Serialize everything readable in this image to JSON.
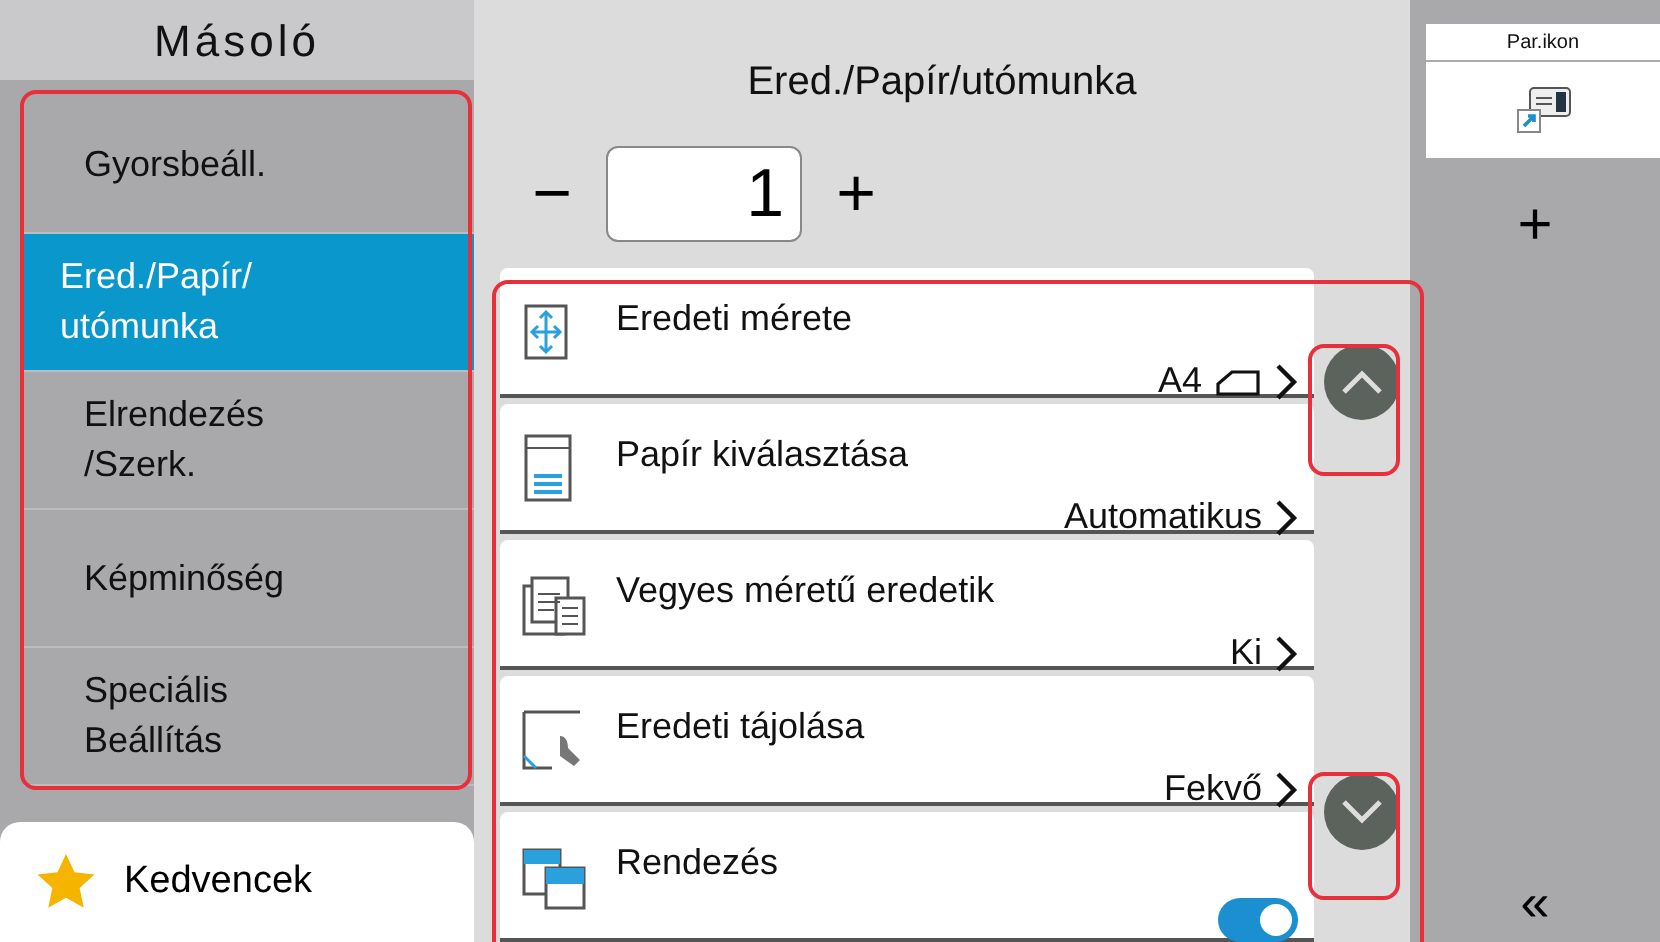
{
  "sidebar": {
    "title": "Másoló",
    "items": [
      {
        "label": "Gyorsbeáll.",
        "selected": false
      },
      {
        "label": "Ered./Papír/\nutómunka",
        "selected": true
      },
      {
        "label": "Elrendezés\n/Szerk.",
        "selected": false
      },
      {
        "label": "Képminőség",
        "selected": false
      },
      {
        "label": "Speciális\nBeállítás",
        "selected": false
      }
    ],
    "favorites": {
      "label": "Kedvencek"
    }
  },
  "main": {
    "title": "Ered./Papír/utómunka",
    "counter": {
      "minus": "−",
      "value": "1",
      "plus": "+"
    },
    "settings": [
      {
        "kind": "value",
        "label": "Eredeti mérete",
        "value": "A4"
      },
      {
        "kind": "value",
        "label": "Papír kiválasztása",
        "value": "Automatikus"
      },
      {
        "kind": "value",
        "label": "Vegyes méretű eredetik",
        "value": "Ki"
      },
      {
        "kind": "value",
        "label": "Eredeti tájolása",
        "value": "Fekvő"
      },
      {
        "kind": "toggle",
        "label": "Rendezés",
        "on": true
      }
    ]
  },
  "right_panel": {
    "tab": "Par.ikon",
    "add": "+",
    "collapse": "«"
  }
}
